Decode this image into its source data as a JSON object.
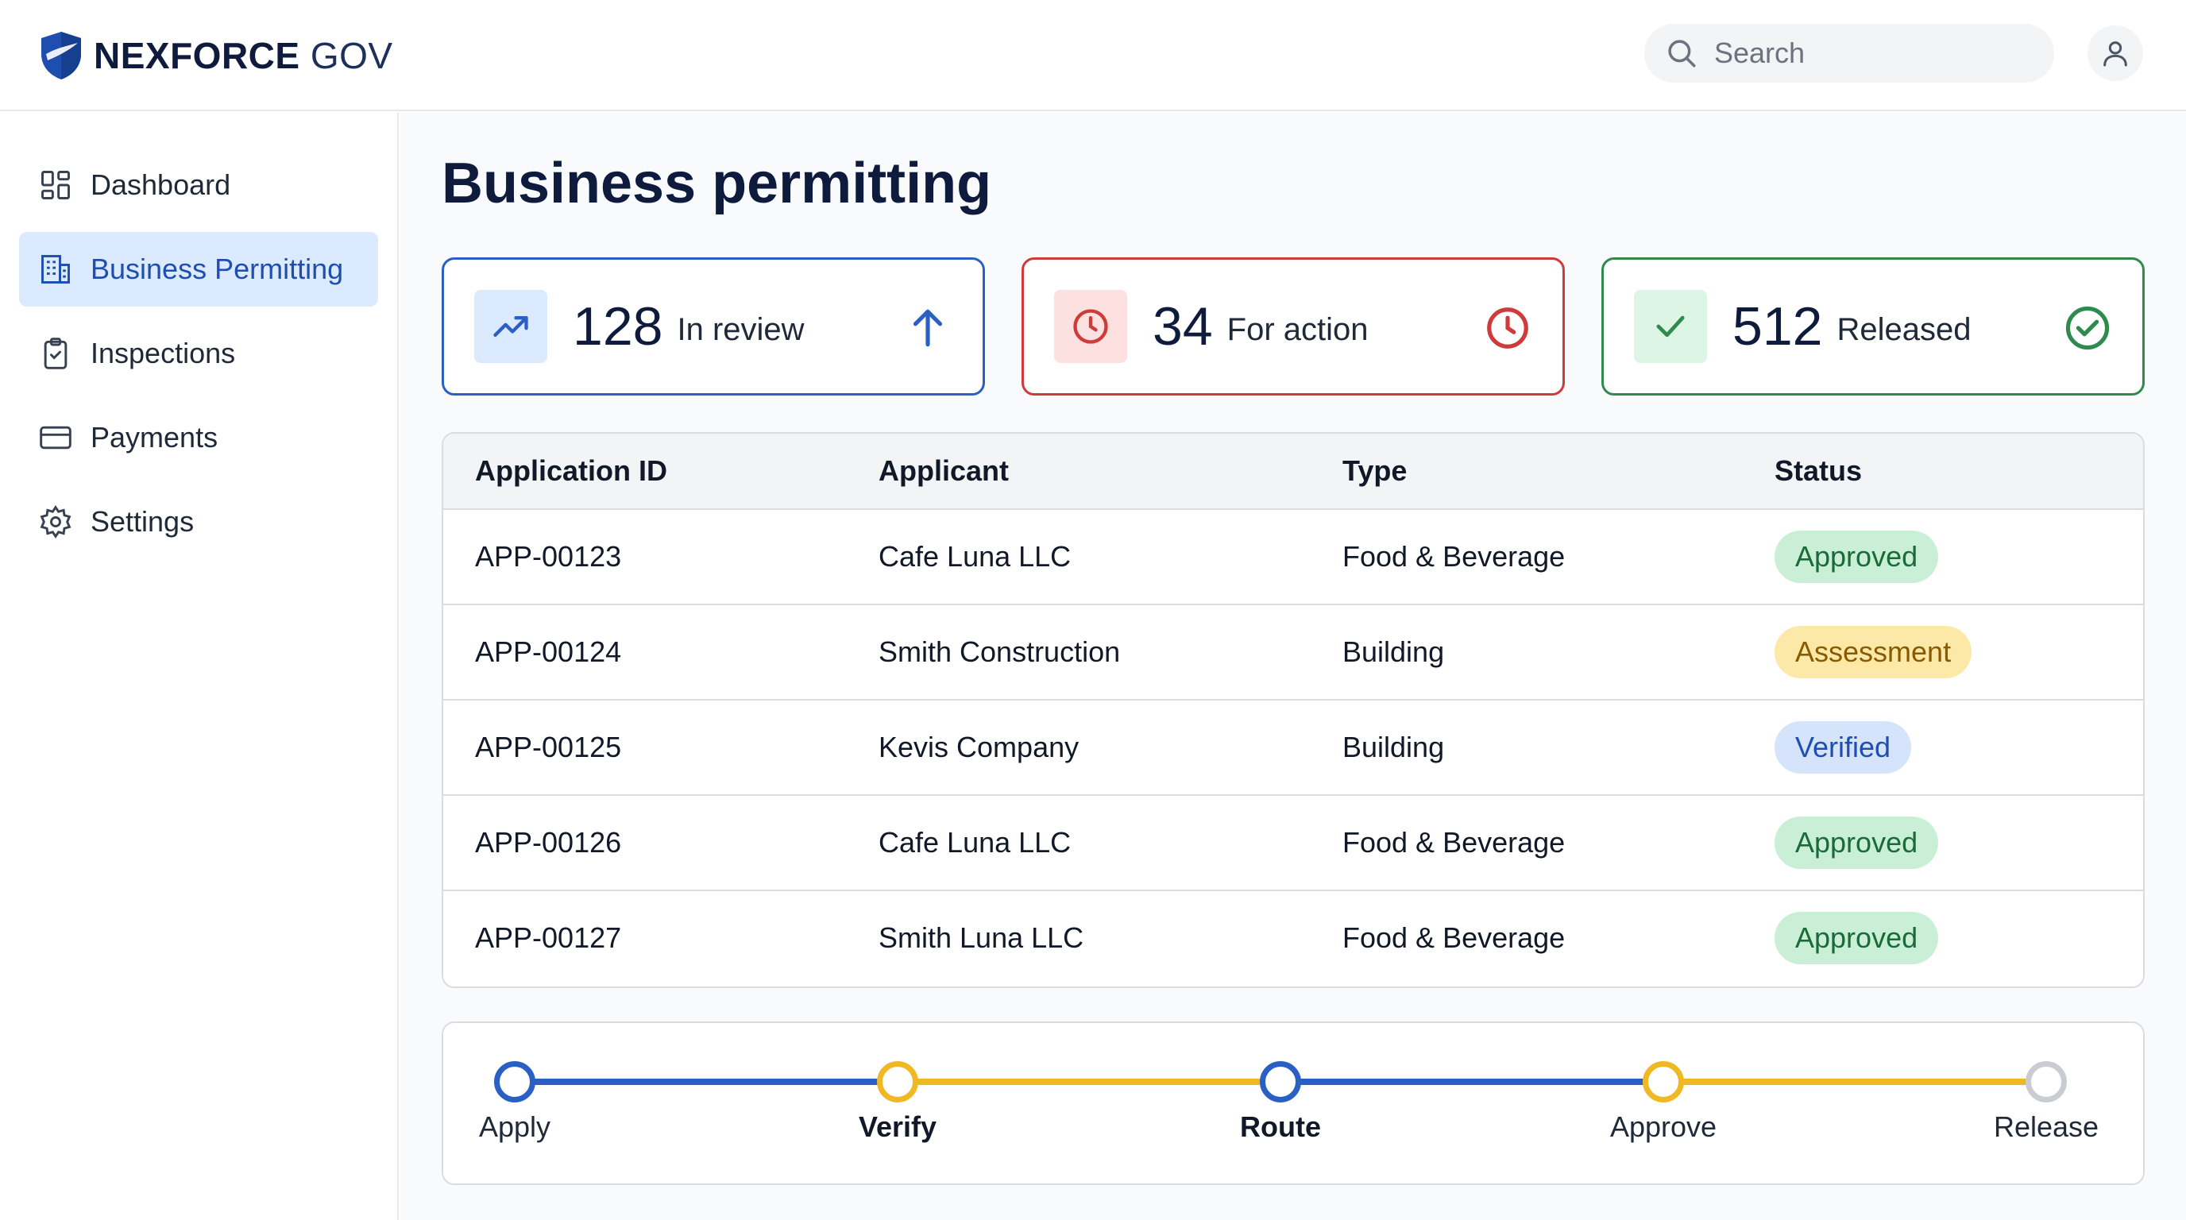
{
  "brand": {
    "name_bold": "NEXFORCE",
    "name_light": "GOV"
  },
  "search": {
    "placeholder": "Search"
  },
  "sidebar": {
    "items": [
      {
        "label": "Dashboard",
        "icon": "dashboard-icon",
        "active": false
      },
      {
        "label": "Business Permitting",
        "icon": "building-icon",
        "active": true
      },
      {
        "label": "Inspections",
        "icon": "clipboard-check-icon",
        "active": false
      },
      {
        "label": "Payments",
        "icon": "credit-card-icon",
        "active": false
      },
      {
        "label": "Settings",
        "icon": "gear-icon",
        "active": false
      }
    ]
  },
  "main": {
    "title": "Business permitting",
    "stats": [
      {
        "value": "128",
        "label": "In review",
        "icon": "trending-up-icon",
        "end_icon": "arrow-up-icon",
        "color": "#2a5fc4"
      },
      {
        "value": "34",
        "label": "For action",
        "icon": "clock-icon",
        "end_icon": "clock-icon",
        "color": "#cf3a3a"
      },
      {
        "value": "512",
        "label": "Released",
        "icon": "check-icon",
        "end_icon": "check-circle-icon",
        "color": "#2f8a4e"
      }
    ],
    "table": {
      "headers": [
        "Application ID",
        "Applicant",
        "Type",
        "Status"
      ],
      "rows": [
        {
          "id": "APP-00123",
          "applicant": "Cafe Luna LLC",
          "type": "Food & Beverage",
          "status": "Approved"
        },
        {
          "id": "APP-00124",
          "applicant": "Smith Construction",
          "type": "Building",
          "status": "Assessment"
        },
        {
          "id": "APP-00125",
          "applicant": "Kevis Company",
          "type": "Building",
          "status": "Verified"
        },
        {
          "id": "APP-00126",
          "applicant": "Cafe Luna LLC",
          "type": "Food & Beverage",
          "status": "Approved"
        },
        {
          "id": "APP-00127",
          "applicant": "Smith Luna LLC",
          "type": "Food & Beverage",
          "status": "Approved"
        }
      ]
    },
    "workflow": {
      "steps": [
        {
          "label": "Apply",
          "color": "#2a5fc4"
        },
        {
          "label": "Verify",
          "color": "#f0b822"
        },
        {
          "label": "Route",
          "color": "#2a5fc4"
        },
        {
          "label": "Approve",
          "color": "#f0b822"
        },
        {
          "label": "Release",
          "color": "#c9ccd1"
        }
      ]
    }
  },
  "colors": {
    "accent": "#2a5fc4",
    "danger": "#cf3a3a",
    "success": "#2f8a4e",
    "warning": "#f0b822"
  }
}
